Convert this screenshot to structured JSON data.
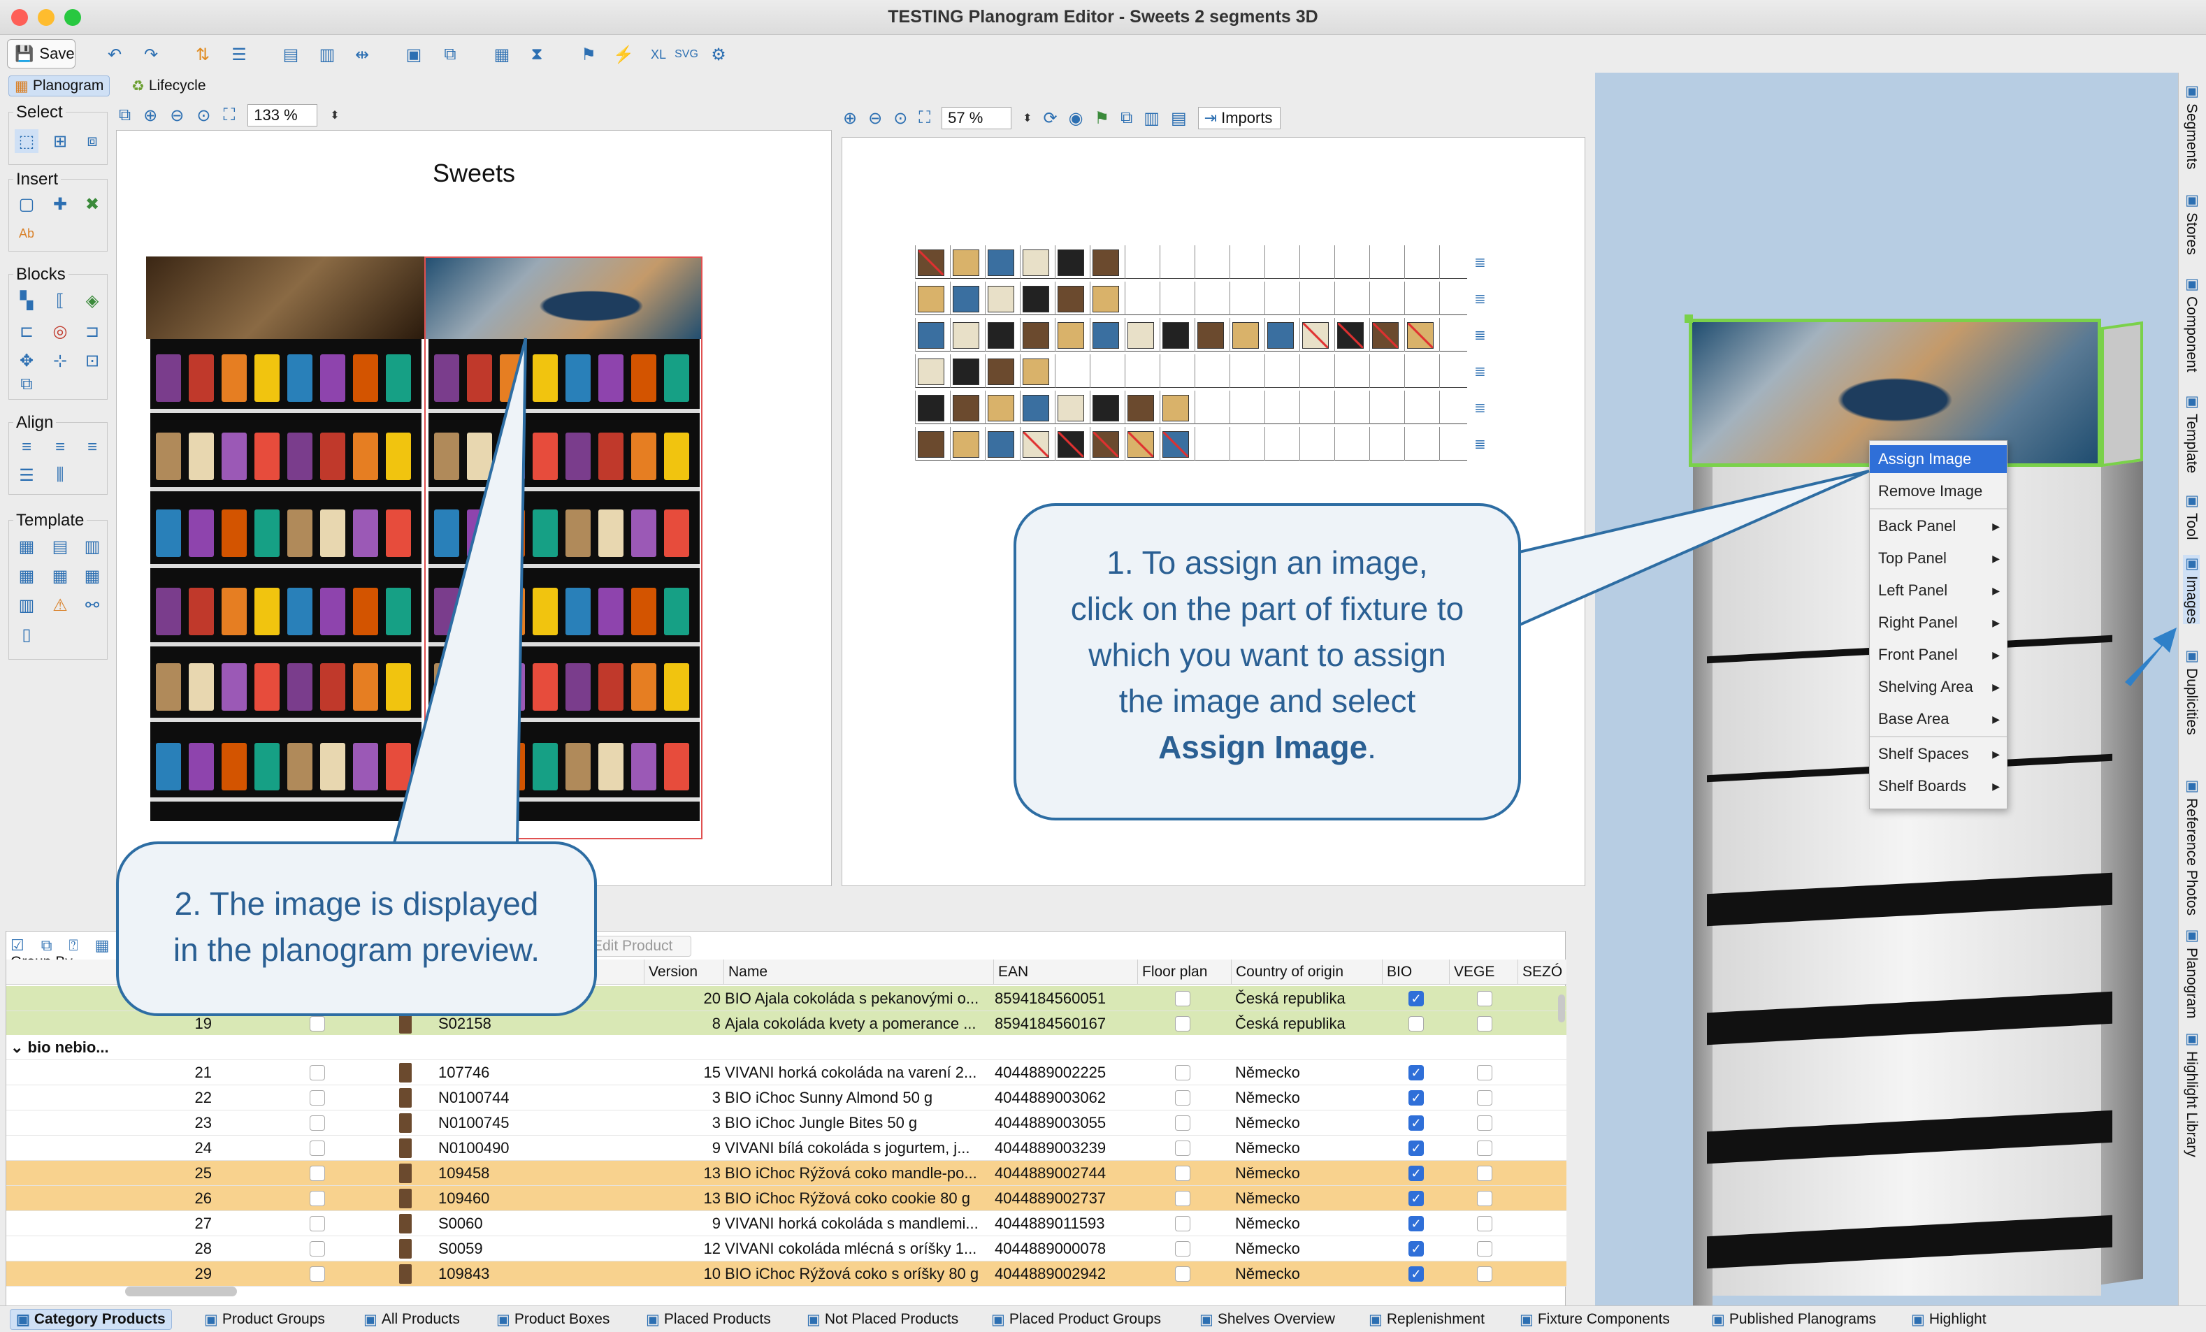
{
  "window": {
    "title": "TESTING Planogram Editor - Sweets 2 segments 3D"
  },
  "toolbar": {
    "save_label": "Save"
  },
  "view_tabs": {
    "planogram": "Planogram",
    "lifecycle": "Lifecycle"
  },
  "palette": {
    "select": "Select",
    "insert": "Insert",
    "blocks": "Blocks",
    "align": "Align",
    "template": "Template"
  },
  "left_view": {
    "zoom": "133 %",
    "title": "Sweets"
  },
  "mid_view": {
    "zoom": "57 %",
    "imports": "Imports"
  },
  "context_menu": {
    "items": [
      "Assign Image",
      "Remove Image",
      "Back Panel",
      "Top Panel",
      "Left Panel",
      "Right Panel",
      "Front Panel",
      "Shelving Area",
      "Base Area",
      "Shelf Spaces",
      "Shelf Boards"
    ]
  },
  "callout1": {
    "line1": "1. To assign an image,",
    "line2": "click on the part of fixture to",
    "line3": "which you want to assign",
    "line4": "the image and select",
    "bold": "Assign Image",
    "tail": "."
  },
  "callout2": {
    "line1": "2. The image is displayed",
    "line2": "in the planogram preview."
  },
  "right_sidebar": [
    "Segments",
    "Stores",
    "Component",
    "Template",
    "Tool",
    "Images",
    "Duplicities",
    "Reference Photos",
    "Planogram",
    "Highlight Library"
  ],
  "table": {
    "edit_product": "Edit Product",
    "group_by": "Group By",
    "columns": [
      "Version",
      "Name",
      "EAN",
      "Floor plan",
      "Country of origin",
      "BIO",
      "VEGE",
      "SEZÓ"
    ],
    "group_label": "bio nebio...",
    "rows": [
      {
        "n": "",
        "code": "",
        "version": "20",
        "name": "BIO Ajala cokoláda s pekanovými o...",
        "ean": "8594184560051",
        "country": "Česká republika",
        "bio": true,
        "hl": "green"
      },
      {
        "n": "19",
        "code": "S02158",
        "version": "8",
        "name": "Ajala cokoláda kvety a pomerance ...",
        "ean": "8594184560167",
        "country": "Česká republika",
        "bio": false,
        "hl": "green"
      },
      {
        "n": "21",
        "code": "107746",
        "version": "15",
        "name": "VIVANI horká cokoláda na varení 2...",
        "ean": "4044889002225",
        "country": "Německo",
        "bio": true,
        "hl": ""
      },
      {
        "n": "22",
        "code": "N0100744",
        "version": "3",
        "name": "BIO iChoc Sunny Almond 50 g",
        "ean": "4044889003062",
        "country": "Německo",
        "bio": true,
        "hl": ""
      },
      {
        "n": "23",
        "code": "N0100745",
        "version": "3",
        "name": "BIO iChoc Jungle Bites 50 g",
        "ean": "4044889003055",
        "country": "Německo",
        "bio": true,
        "hl": ""
      },
      {
        "n": "24",
        "code": "N0100490",
        "version": "9",
        "name": "VIVANI bílá cokoláda s jogurtem, j...",
        "ean": "4044889003239",
        "country": "Německo",
        "bio": true,
        "hl": ""
      },
      {
        "n": "25",
        "code": "109458",
        "version": "13",
        "name": "BIO iChoc Rýžová coko mandle-po...",
        "ean": "4044889002744",
        "country": "Německo",
        "bio": true,
        "hl": "orange"
      },
      {
        "n": "26",
        "code": "109460",
        "version": "13",
        "name": "BIO iChoc Rýžová coko cookie 80 g",
        "ean": "4044889002737",
        "country": "Německo",
        "bio": true,
        "hl": "orange"
      },
      {
        "n": "27",
        "code": "S0060",
        "version": "9",
        "name": "VIVANI horká cokoláda s mandlemi...",
        "ean": "4044889011593",
        "country": "Německo",
        "bio": true,
        "hl": ""
      },
      {
        "n": "28",
        "code": "S0059",
        "version": "12",
        "name": "VIVANI cokoláda mlécná s oríšky 1...",
        "ean": "4044889000078",
        "country": "Německo",
        "bio": true,
        "hl": ""
      },
      {
        "n": "29",
        "code": "109843",
        "version": "10",
        "name": "BIO iChoc Rýžová coko s oríšky 80 g",
        "ean": "4044889002942",
        "country": "Německo",
        "bio": true,
        "hl": "orange"
      }
    ]
  },
  "bottom_tabs": [
    "Category Products",
    "Product Groups",
    "All Products",
    "Product Boxes",
    "Placed Products",
    "Not Placed Products",
    "Placed Product Groups",
    "Shelves Overview",
    "Replenishment",
    "Fixture Components",
    "Published Planograms",
    "Highlight"
  ],
  "colors": {
    "accent": "#2c6fb2",
    "row_green": "#d9e8b5",
    "row_orange": "#f8d28e",
    "callout_border": "#2d6da3"
  }
}
